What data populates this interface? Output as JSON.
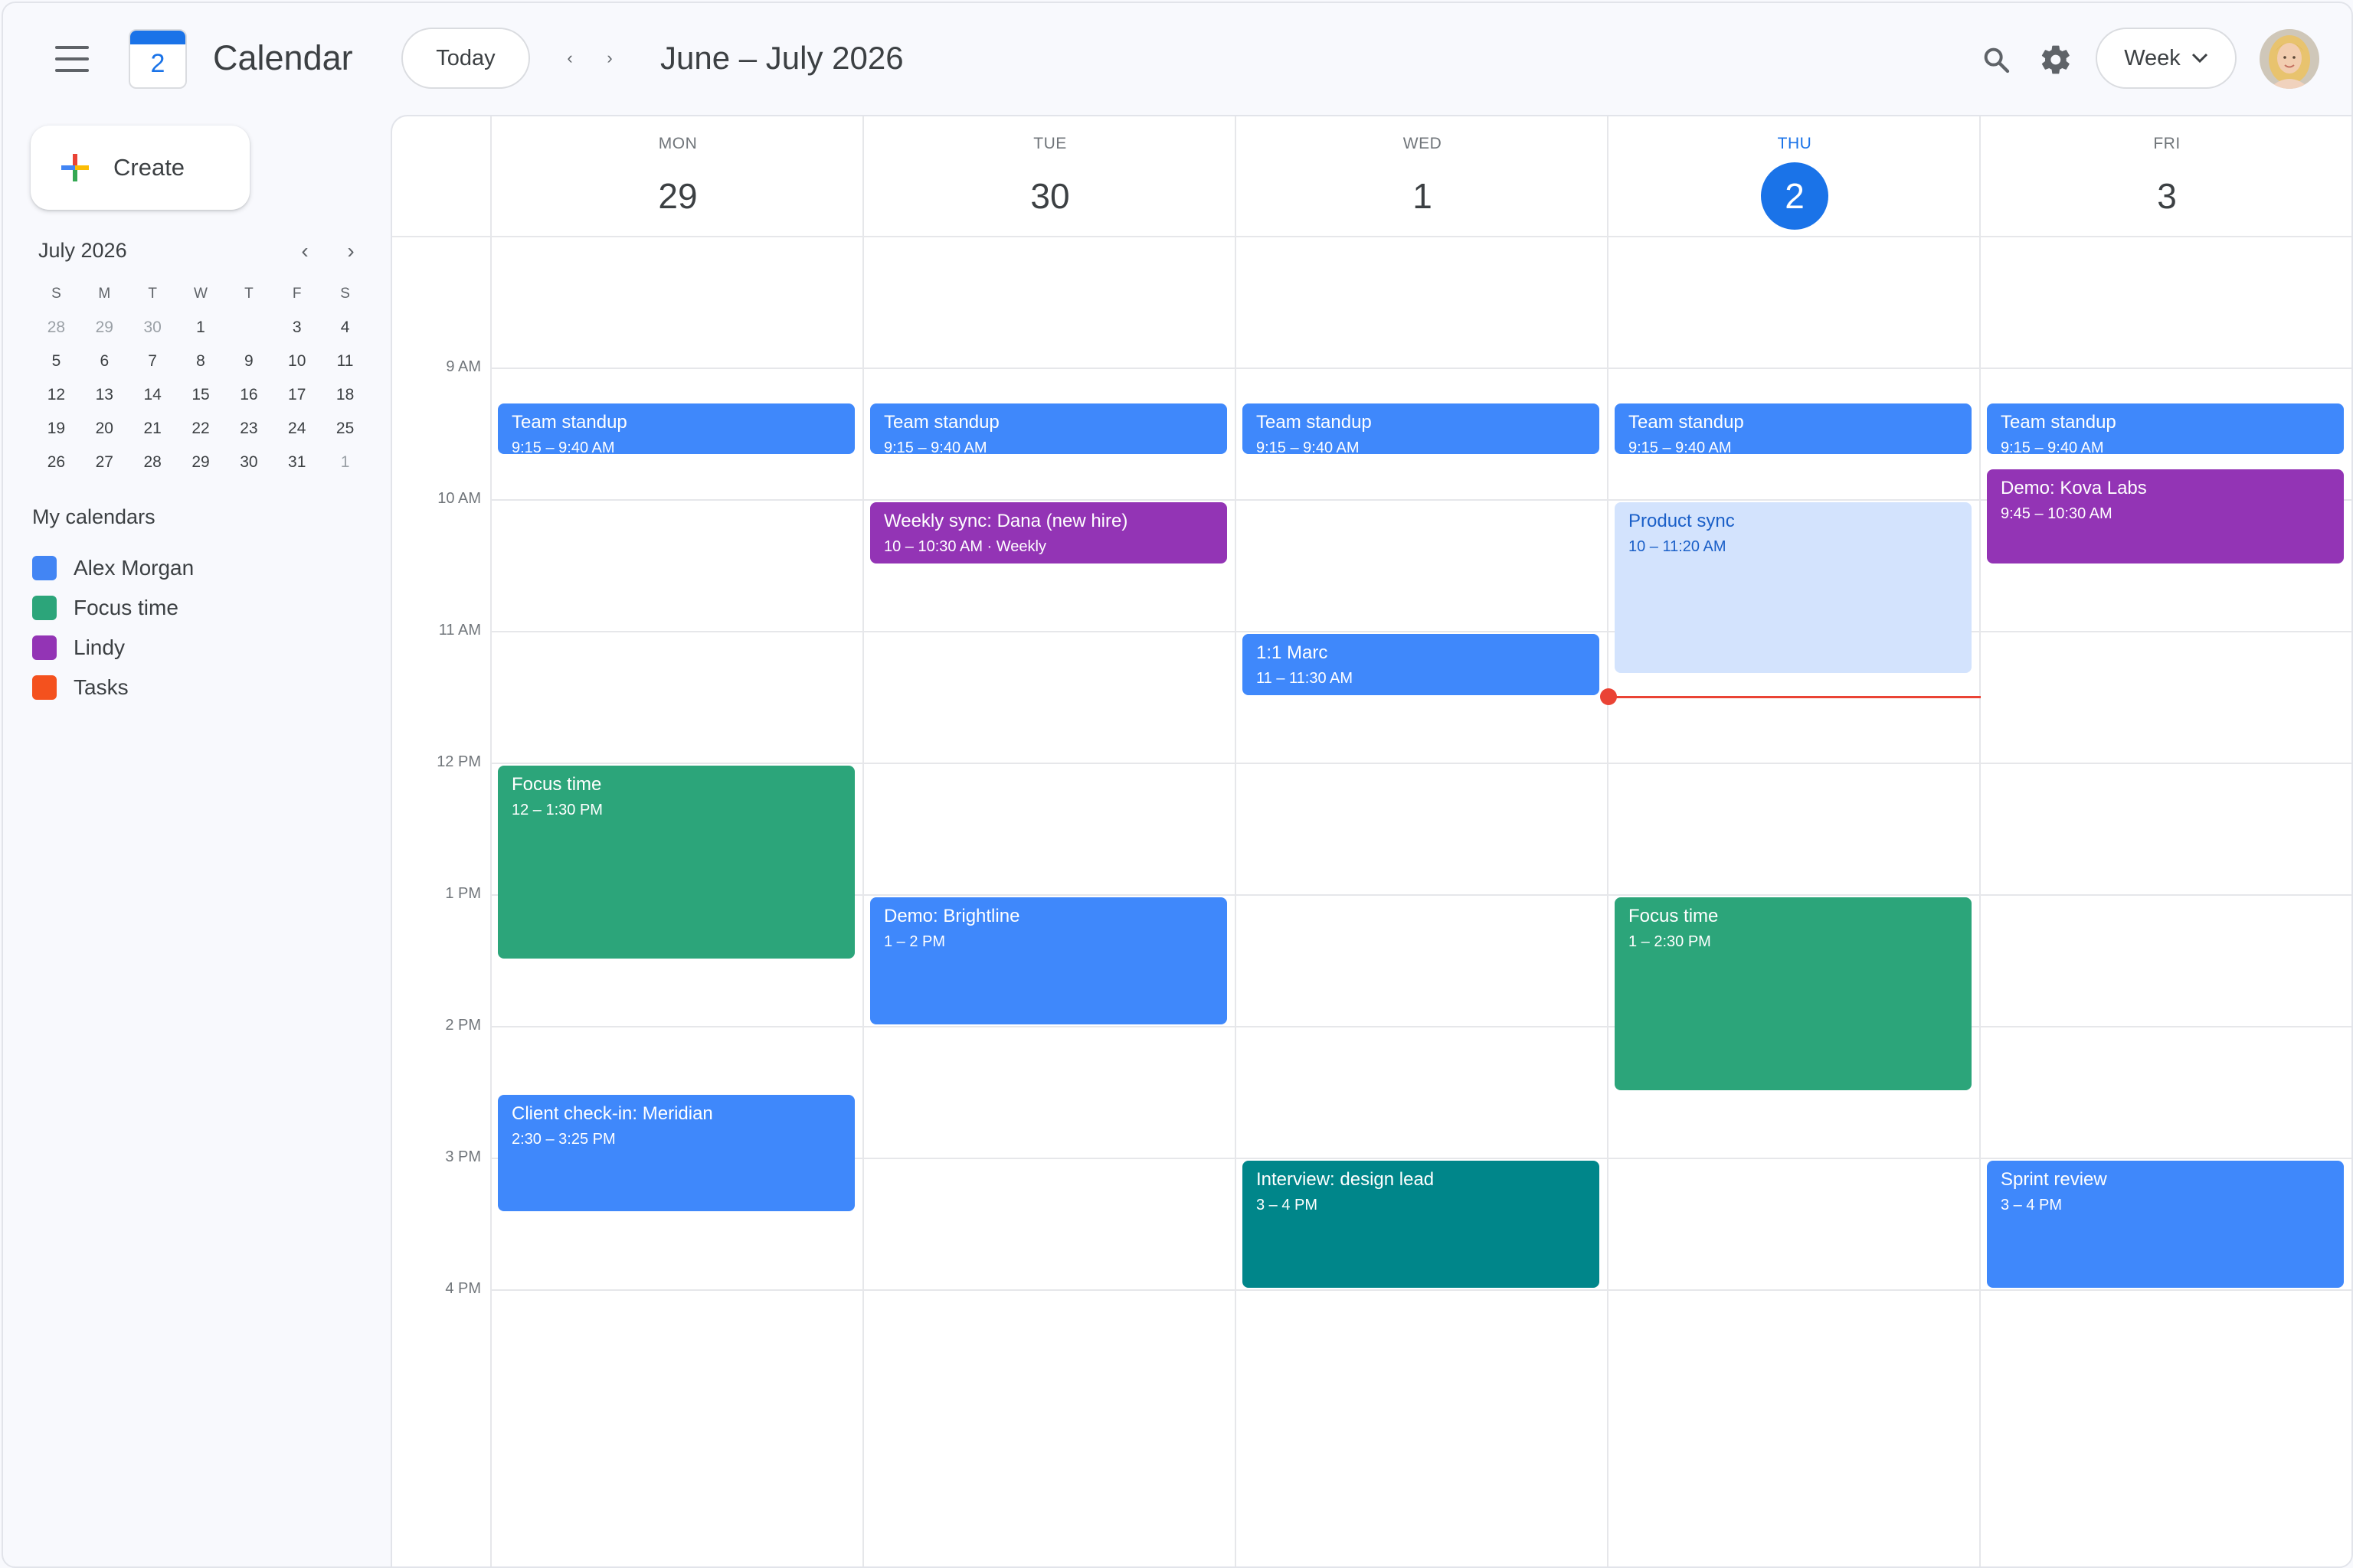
{
  "header": {
    "app_title": "Calendar",
    "logo_day": "2",
    "today_label": "Today",
    "prev_label": "‹",
    "next_label": "›",
    "range_title": "June – July 2026",
    "view_label": "Week"
  },
  "sidebar": {
    "create_label": "Create",
    "mini_month": "July 2026",
    "mini_prev": "‹",
    "mini_next": "›",
    "weekday_headers": [
      "S",
      "M",
      "T",
      "W",
      "T",
      "F",
      "S"
    ],
    "weeks": [
      [
        "28",
        "29",
        "30",
        "1",
        "",
        "3",
        "4"
      ],
      [
        "5",
        "6",
        "7",
        "8",
        "9",
        "10",
        "11"
      ],
      [
        "12",
        "13",
        "14",
        "15",
        "16",
        "17",
        "18"
      ],
      [
        "19",
        "20",
        "21",
        "22",
        "23",
        "24",
        "25"
      ],
      [
        "26",
        "27",
        "28",
        "29",
        "30",
        "31",
        "1"
      ]
    ],
    "my_calendars_title": "My calendars",
    "calendars": [
      {
        "name": "Alex Morgan",
        "color": "#4285f4"
      },
      {
        "name": "Focus time",
        "color": "#2ca57a"
      },
      {
        "name": "Lindy",
        "color": "#9334b5"
      },
      {
        "name": "Tasks",
        "color": "#f4511e"
      }
    ]
  },
  "days": [
    {
      "dow": "MON",
      "num": "29",
      "today": false
    },
    {
      "dow": "TUE",
      "num": "30",
      "today": false
    },
    {
      "dow": "WED",
      "num": "1",
      "today": false
    },
    {
      "dow": "THU",
      "num": "2",
      "today": true
    },
    {
      "dow": "FRI",
      "num": "3",
      "today": false
    }
  ],
  "hours": [
    "9 AM",
    "10 AM",
    "11 AM",
    "12 PM",
    "1 PM",
    "2 PM",
    "3 PM",
    "4 PM"
  ],
  "colors": {
    "blue": "#3f88fb",
    "purple": "#9334b5",
    "green": "#2ca57a",
    "teal": "#00868a",
    "light_blue": "#d3e3fd",
    "light_blue_text": "#1a5fc8",
    "now": "#ea4335",
    "accent": "#1a73e8"
  },
  "events": [
    {
      "day": 0,
      "start": 9.25,
      "end": 9.6667,
      "title": "Team standup",
      "time": "9:15 – 9:40 AM",
      "color": "blue"
    },
    {
      "day": 1,
      "start": 9.25,
      "end": 9.6667,
      "title": "Team standup",
      "time": "9:15 – 9:40 AM",
      "color": "blue"
    },
    {
      "day": 2,
      "start": 9.25,
      "end": 9.6667,
      "title": "Team standup",
      "time": "9:15 – 9:40 AM",
      "color": "blue"
    },
    {
      "day": 3,
      "start": 9.25,
      "end": 9.6667,
      "title": "Team standup",
      "time": "9:15 – 9:40 AM",
      "color": "blue"
    },
    {
      "day": 4,
      "start": 9.25,
      "end": 9.6667,
      "title": "Team standup",
      "time": "9:15 – 9:40 AM",
      "color": "blue"
    },
    {
      "day": 1,
      "start": 10,
      "end": 10.5,
      "title": "Weekly sync: Dana (new hire)",
      "time": "10 – 10:30 AM · Weekly",
      "color": "purple"
    },
    {
      "day": 3,
      "start": 10,
      "end": 11.3333,
      "title": "Product sync",
      "time": "10 – 11:20 AM",
      "color": "light_blue"
    },
    {
      "day": 4,
      "start": 9.75,
      "end": 10.5,
      "title": "Demo: Kova Labs",
      "time": "9:45 – 10:30 AM",
      "color": "purple"
    },
    {
      "day": 2,
      "start": 11,
      "end": 11.5,
      "title": "1:1 Marc",
      "time": "11 – 11:30 AM",
      "color": "blue"
    },
    {
      "day": 0,
      "start": 12,
      "end": 13.5,
      "title": "Focus time",
      "time": "12 – 1:30 PM",
      "color": "green"
    },
    {
      "day": 1,
      "start": 13,
      "end": 14,
      "title": "Demo: Brightline",
      "time": "1 – 2 PM",
      "color": "blue"
    },
    {
      "day": 3,
      "start": 13,
      "end": 14.5,
      "title": "Focus time",
      "time": "1 – 2:30 PM",
      "color": "green"
    },
    {
      "day": 0,
      "start": 14.5,
      "end": 15.4167,
      "title": "Client check-in: Meridian",
      "time": "2:30 – 3:25 PM",
      "color": "blue"
    },
    {
      "day": 2,
      "start": 15,
      "end": 16,
      "title": "Interview: design lead",
      "time": "3 – 4 PM",
      "color": "teal"
    },
    {
      "day": 4,
      "start": 15,
      "end": 16,
      "title": "Sprint review",
      "time": "3 – 4 PM",
      "color": "blue"
    }
  ],
  "now": {
    "day": 3,
    "hour": 11.5
  }
}
